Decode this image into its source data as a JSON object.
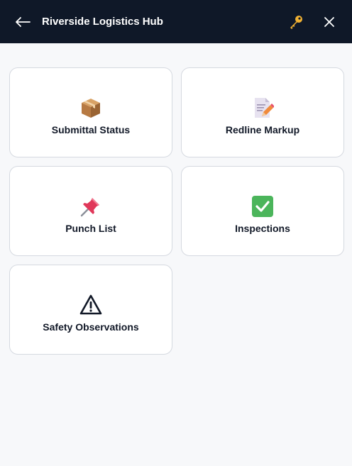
{
  "header": {
    "title": "Riverside Logistics Hub",
    "background": "#0f1828",
    "back_icon": "arrow-left-icon",
    "key_icon": "key-icon",
    "close_icon": "close-icon"
  },
  "tiles": [
    {
      "label": "Submittal Status",
      "icon": "package-icon"
    },
    {
      "label": "Redline Markup",
      "icon": "memo-pencil-icon"
    },
    {
      "label": "Punch List",
      "icon": "pushpin-icon"
    },
    {
      "label": "Inspections",
      "icon": "check-mark-button-icon"
    },
    {
      "label": "Safety Observations",
      "icon": "warning-icon"
    }
  ]
}
